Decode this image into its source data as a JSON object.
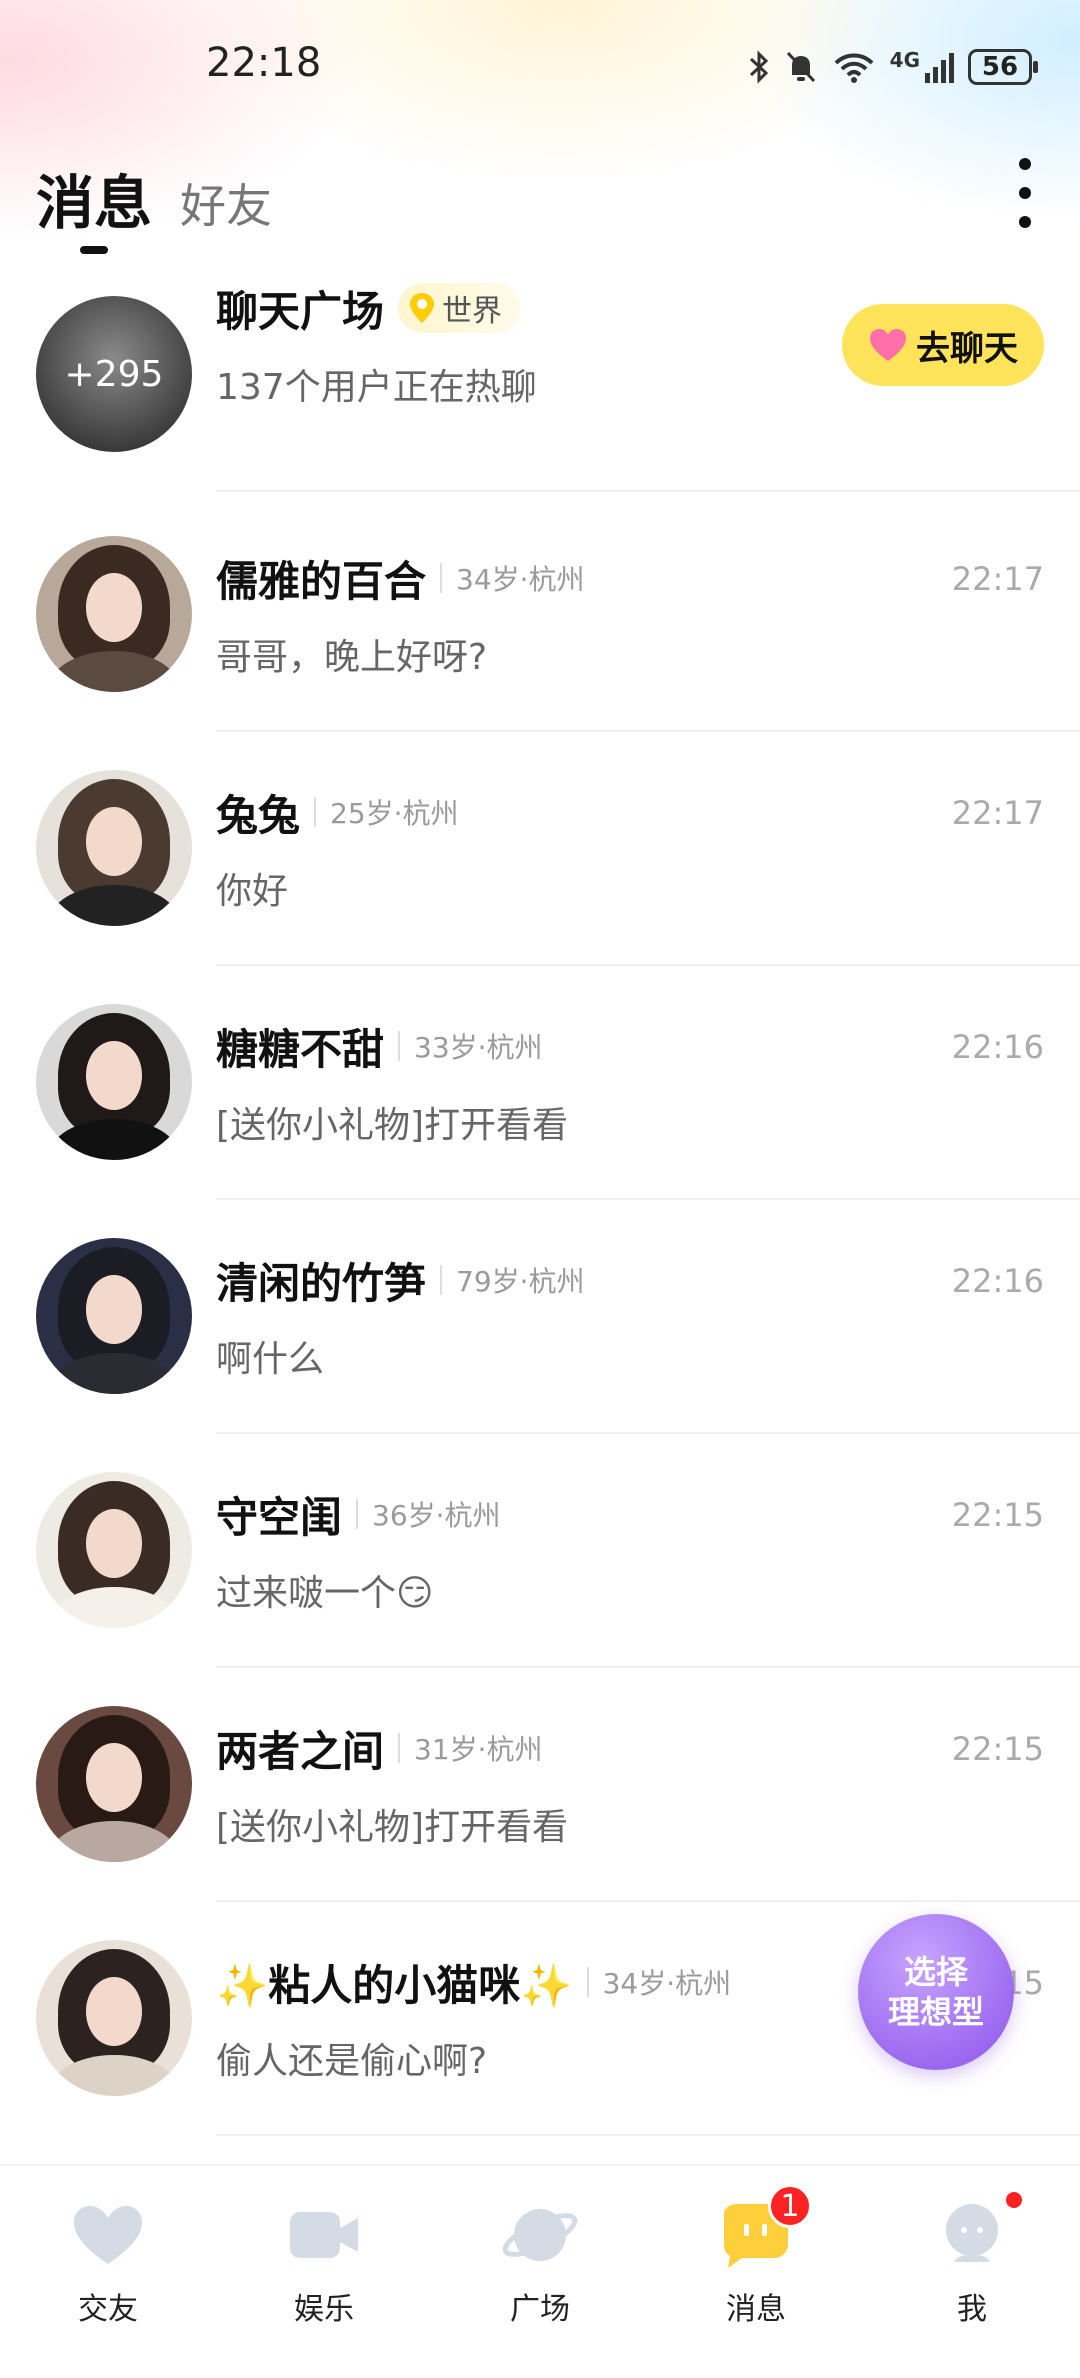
{
  "status_bar": {
    "time": "22:18",
    "network": "4G",
    "battery": "56"
  },
  "header": {
    "tab_active": "消息",
    "tab_inactive": "好友"
  },
  "plaza": {
    "name": "聊天广场",
    "count_badge": "+295",
    "location": "世界",
    "subtitle": "137个用户正在热聊",
    "button_label": "去聊天"
  },
  "conversations": [
    {
      "name": "儒雅的百合",
      "meta": "34岁·杭州",
      "time": "22:17",
      "preview": "哥哥，晚上好呀?"
    },
    {
      "name": "兔兔",
      "meta": "25岁·杭州",
      "time": "22:17",
      "preview": "你好"
    },
    {
      "name": "糖糖不甜",
      "meta": "33岁·杭州",
      "time": "22:16",
      "preview": "[送你小礼物]打开看看"
    },
    {
      "name": "清闲的竹笋",
      "meta": "79岁·杭州",
      "time": "22:16",
      "preview": "啊什么"
    },
    {
      "name": "守空闺",
      "meta": "36岁·杭州",
      "time": "22:15",
      "preview": "过来啵一个😏"
    },
    {
      "name": "两者之间",
      "meta": "31岁·杭州",
      "time": "22:15",
      "preview": "[送你小礼物]打开看看"
    },
    {
      "name": "✨粘人的小猫咪✨",
      "meta": "34岁·杭州",
      "time": "22:15",
      "preview": "偷人还是偷心啊?"
    }
  ],
  "floating_button": {
    "line1": "选择",
    "line2": "理想型"
  },
  "bottom_nav": [
    {
      "label": "交友",
      "icon": "heart-icon"
    },
    {
      "label": "娱乐",
      "icon": "video-camera-icon"
    },
    {
      "label": "广场",
      "icon": "planet-icon"
    },
    {
      "label": "消息",
      "icon": "chat-bubble-icon",
      "badge": "1"
    },
    {
      "label": "我",
      "icon": "profile-icon"
    }
  ],
  "colors": {
    "accent_yellow": "#ffe45b",
    "badge_red": "#ff2222",
    "float_purple": "#9a66ef"
  }
}
